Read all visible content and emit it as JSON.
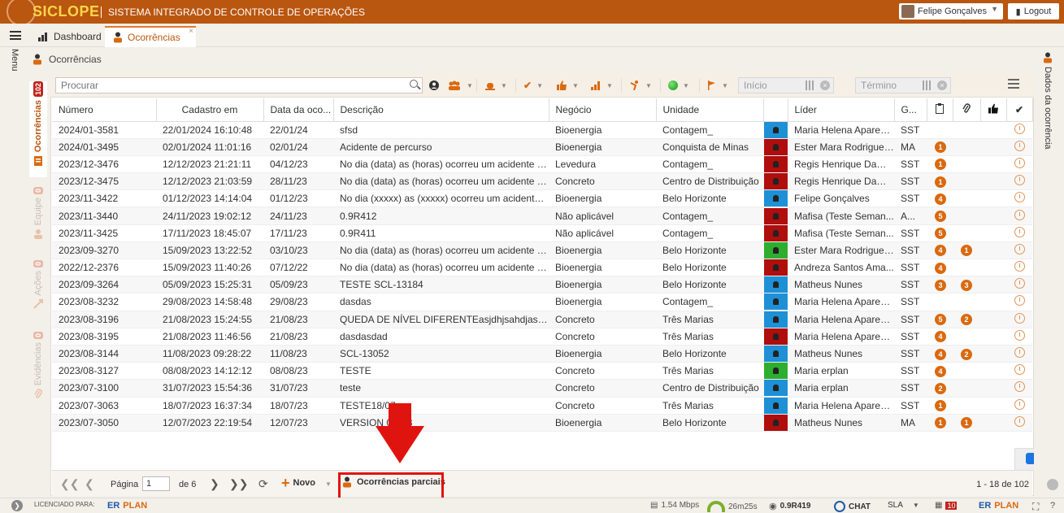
{
  "app": {
    "logo_text": "SICLOPE",
    "system_title": "SISTEMA INTEGRADO DE CONTROLE DE OPERAÇÕES",
    "user_name": "Felipe Gonçalves",
    "logout_label": "Logout",
    "brand_color": "#b9560f",
    "accent_color": "#d96a10"
  },
  "tabs": [
    {
      "label": "Dashboard",
      "icon": "bar-chart-icon"
    },
    {
      "label": "Ocorrências",
      "icon": "person-alert-icon",
      "active": true
    }
  ],
  "menu_label": "Menu",
  "panel_title": "Ocorrências",
  "left_tabs": [
    {
      "label": "Ocorrências",
      "badge": "102",
      "active": true
    },
    {
      "label": "Equipe",
      "badge": "0"
    },
    {
      "label": "Ações",
      "badge": "0"
    },
    {
      "label": "Evidências",
      "badge": "0"
    }
  ],
  "right_tab_label": "Dados da ocorrência",
  "filters": {
    "search_placeholder": "Procurar",
    "start_placeholder": "Início",
    "end_placeholder": "Término"
  },
  "table": {
    "headers": [
      "Número",
      "Cadastro em",
      "Data da oco...",
      "Descrição",
      "Negócio",
      "Unidade",
      "",
      "Líder",
      "G..."
    ],
    "rows": [
      {
        "numero": "2024/01-3581",
        "cadastro": "22/01/2024 16:10:48",
        "data": "22/01/24",
        "descricao": "sfsd",
        "negocio": "Bioenergia",
        "unidade": "Contagem_",
        "color": "#1e90d6",
        "lider": "Maria Helena Apareci...",
        "g": "SST",
        "b1": "",
        "b2": ""
      },
      {
        "numero": "2024/01-3495",
        "cadastro": "02/01/2024 11:01:16",
        "data": "02/01/24",
        "descricao": "Acidente de percurso",
        "negocio": "Bioenergia",
        "unidade": "Conquista de Minas",
        "color": "#b00d0d",
        "lider": "Ester Mara Rodrigues...",
        "g": "MA",
        "b1": "1",
        "b2": ""
      },
      {
        "numero": "2023/12-3476",
        "cadastro": "12/12/2023 21:21:11",
        "data": "04/12/23",
        "descricao": "No dia (data) as (horas) ocorreu um acidente no ...",
        "negocio": "Levedura",
        "unidade": "Contagem_",
        "color": "#b00d0d",
        "lider": "Regis Henrique Dama...",
        "g": "SST",
        "b1": "1",
        "b2": ""
      },
      {
        "numero": "2023/12-3475",
        "cadastro": "12/12/2023 21:03:59",
        "data": "28/11/23",
        "descricao": "No dia (data) as (horas) ocorreu um acidente no ...",
        "negocio": "Concreto",
        "unidade": "Centro de Distribuição",
        "color": "#b00d0d",
        "lider": "Regis Henrique Dama...",
        "g": "SST",
        "b1": "1",
        "b2": ""
      },
      {
        "numero": "2023/11-3422",
        "cadastro": "01/12/2023 14:14:04",
        "data": "01/12/23",
        "descricao": "No dia (xxxxx) as (xxxxx) ocorreu um acidente n...",
        "negocio": "Bioenergia",
        "unidade": "Belo Horizonte",
        "color": "#1e90d6",
        "lider": "Felipe Gonçalves",
        "g": "SST",
        "b1": "4",
        "b2": ""
      },
      {
        "numero": "2023/11-3440",
        "cadastro": "24/11/2023 19:02:12",
        "data": "24/11/23",
        "descricao": "0.9R412",
        "negocio": "Não aplicável",
        "unidade": "Contagem_",
        "color": "#b00d0d",
        "lider": "Mafisa (Teste Seman...",
        "g": "A...",
        "b1": "5",
        "b2": ""
      },
      {
        "numero": "2023/11-3425",
        "cadastro": "17/11/2023 18:45:07",
        "data": "17/11/23",
        "descricao": "0.9R411",
        "negocio": "Não aplicável",
        "unidade": "Contagem_",
        "color": "#b00d0d",
        "lider": "Mafisa (Teste Seman...",
        "g": "SST",
        "b1": "5",
        "b2": ""
      },
      {
        "numero": "2023/09-3270",
        "cadastro": "15/09/2023 13:22:52",
        "data": "03/10/23",
        "descricao": "No dia (data) as (horas) ocorreu um acidente no ...",
        "negocio": "Bioenergia",
        "unidade": "Belo Horizonte",
        "color": "#2eae2e",
        "lider": "Ester Mara Rodrigues...",
        "g": "SST",
        "b1": "4",
        "b2": "1"
      },
      {
        "numero": "2022/12-2376",
        "cadastro": "15/09/2023 11:40:26",
        "data": "07/12/22",
        "descricao": "No dia (data) as (horas) ocorreu um acidente no ...",
        "negocio": "Bioenergia",
        "unidade": "Belo Horizonte",
        "color": "#b00d0d",
        "lider": "Andreza Santos Ama...",
        "g": "SST",
        "b1": "4",
        "b2": ""
      },
      {
        "numero": "2023/09-3264",
        "cadastro": "05/09/2023 15:25:31",
        "data": "05/09/23",
        "descricao": "TESTE SCL-13184",
        "negocio": "Bioenergia",
        "unidade": "Belo Horizonte",
        "color": "#1e90d6",
        "lider": "Matheus Nunes",
        "g": "SST",
        "b1": "3",
        "b2": "3"
      },
      {
        "numero": "2023/08-3232",
        "cadastro": "29/08/2023 14:58:48",
        "data": "29/08/23",
        "descricao": "dasdas",
        "negocio": "Bioenergia",
        "unidade": "Contagem_",
        "color": "#1e90d6",
        "lider": "Maria Helena Apareci...",
        "g": "SST",
        "b1": "",
        "b2": ""
      },
      {
        "numero": "2023/08-3196",
        "cadastro": "21/08/2023 15:24:55",
        "data": "21/08/23",
        "descricao": "QUEDA DE NÍVEL DIFERENTEasjdhjsahdjashjkdh...",
        "negocio": "Concreto",
        "unidade": "Três Marias",
        "color": "#1e90d6",
        "lider": "Maria Helena Apareci...",
        "g": "SST",
        "b1": "5",
        "b2": "2"
      },
      {
        "numero": "2023/08-3195",
        "cadastro": "21/08/2023 11:46:56",
        "data": "21/08/23",
        "descricao": "dasdasdad",
        "negocio": "Concreto",
        "unidade": "Três Marias",
        "color": "#b00d0d",
        "lider": "Maria Helena Apareci...",
        "g": "SST",
        "b1": "4",
        "b2": ""
      },
      {
        "numero": "2023/08-3144",
        "cadastro": "11/08/2023 09:28:22",
        "data": "11/08/23",
        "descricao": "SCL-13052",
        "negocio": "Bioenergia",
        "unidade": "Belo Horizonte",
        "color": "#1e90d6",
        "lider": "Matheus Nunes",
        "g": "SST",
        "b1": "4",
        "b2": "2"
      },
      {
        "numero": "2023/08-3127",
        "cadastro": "08/08/2023 14:12:12",
        "data": "08/08/23",
        "descricao": "TESTE",
        "negocio": "Concreto",
        "unidade": "Três Marias",
        "color": "#2eae2e",
        "lider": "Maria erplan",
        "g": "SST",
        "b1": "4",
        "b2": ""
      },
      {
        "numero": "2023/07-3100",
        "cadastro": "31/07/2023 15:54:36",
        "data": "31/07/23",
        "descricao": "teste",
        "negocio": "Concreto",
        "unidade": "Centro de Distribuição",
        "color": "#1e90d6",
        "lider": "Maria erplan",
        "g": "SST",
        "b1": "2",
        "b2": ""
      },
      {
        "numero": "2023/07-3063",
        "cadastro": "18/07/2023 16:37:34",
        "data": "18/07/23",
        "descricao": "TESTE18/07",
        "negocio": "Concreto",
        "unidade": "Três Marias",
        "color": "#1e90d6",
        "lider": "Maria Helena Apareci...",
        "g": "SST",
        "b1": "1",
        "b2": ""
      },
      {
        "numero": "2023/07-3050",
        "cadastro": "12/07/2023 22:19:54",
        "data": "12/07/23",
        "descricao": "VERSION 0.9R3",
        "negocio": "Bioenergia",
        "unidade": "Belo Horizonte",
        "color": "#b00d0d",
        "lider": "Matheus Nunes",
        "g": "MA",
        "b1": "1",
        "b2": "1"
      }
    ]
  },
  "pager": {
    "page_label": "Página",
    "page_value": "1",
    "of_label": "de 6",
    "new_label": "Novo",
    "partial_label": "Ocorrências parciais",
    "range_label": "1 - 18 de 102"
  },
  "status": {
    "licensed_label": "LICENCIADO PARA:",
    "erplan_a": "ER",
    "erplan_b": "PLAN",
    "speed": "1.54 Mbps",
    "timer": "26m25s",
    "version": "0.9R419",
    "chat": "CHAT",
    "sla": "SLA",
    "notif_count": "10"
  }
}
